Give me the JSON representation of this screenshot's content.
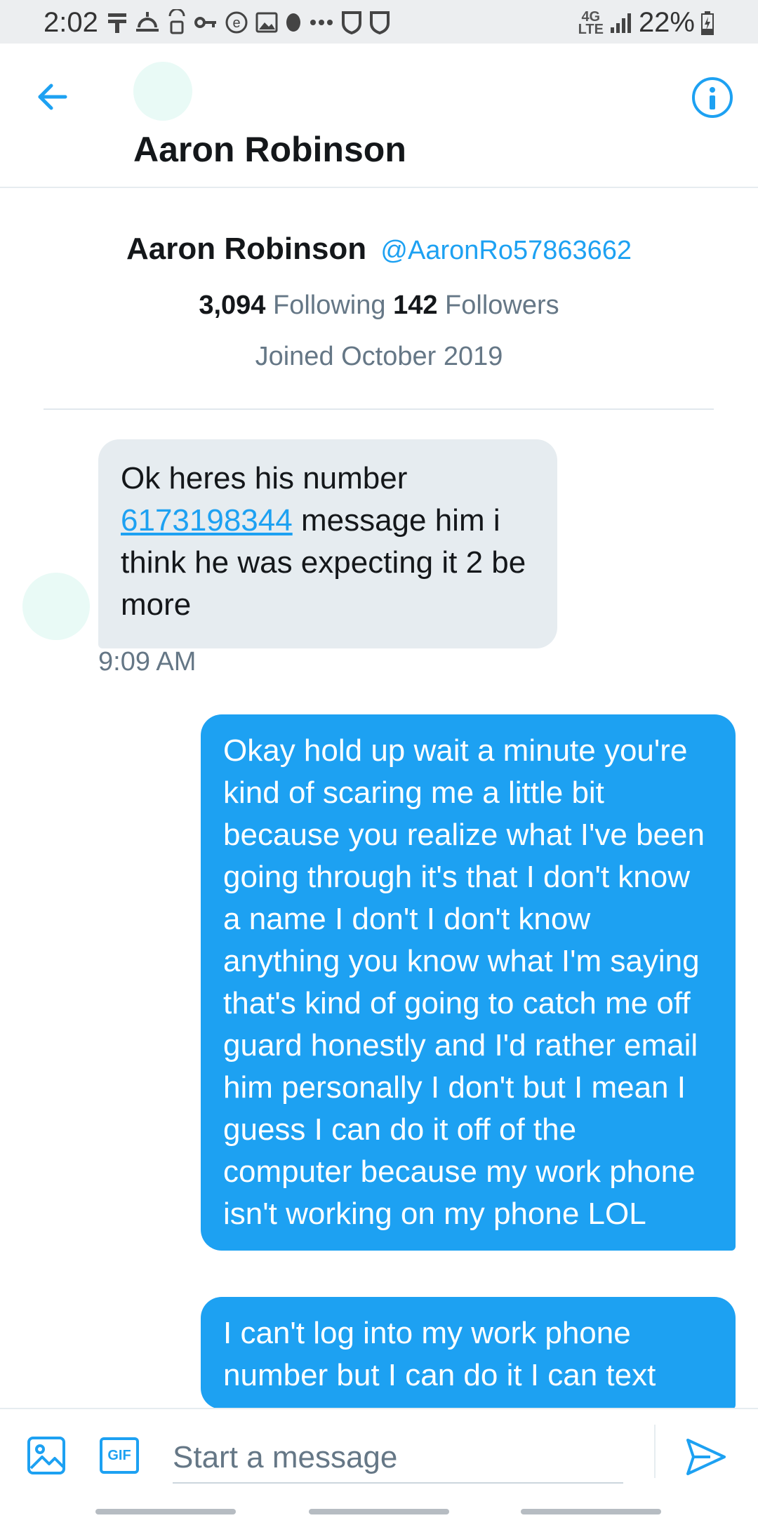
{
  "status_bar": {
    "time": "2:02",
    "network": "4G",
    "network_sub": "LTE",
    "battery": "22%",
    "icons": [
      "notification-icon",
      "weather-icon",
      "vpn-lock-icon",
      "key-icon",
      "browser-e-icon",
      "image-icon",
      "dot-icon",
      "more-dots-icon",
      "shield-icon",
      "shield-icon"
    ]
  },
  "header": {
    "title": "Aaron Robinson",
    "back_icon": "arrow-left-icon",
    "info_icon": "info-icon"
  },
  "profile": {
    "name": "Aaron Robinson",
    "handle": "@AaronRo57863662",
    "following_count": "3,094",
    "following_label": "Following",
    "followers_count": "142",
    "followers_label": "Followers",
    "joined": "Joined October 2019"
  },
  "messages": {
    "incoming": {
      "pre": "Ok heres his number ",
      "link": "6173198344",
      "post": " message him i think he was expecting it 2 be more",
      "time": "9:09 AM"
    },
    "outgoing": [
      {
        "text": "Okay hold up wait a minute you're kind of scaring me a little bit because you realize what I've been going through it's that I don't know a name I don't I don't know anything you know what I'm saying that's kind of going to catch me off guard honestly and I'd rather email him personally I don't but I mean I guess I can do it off of the computer because my work phone isn't working on my phone LOL"
      },
      {
        "text": "I can't log into my work phone number but I can do it I can text"
      }
    ]
  },
  "composer": {
    "placeholder": "Start a message",
    "gif_label": "GIF",
    "media_icon": "image-icon",
    "send_icon": "send-icon"
  },
  "colors": {
    "accent": "#1da1f2",
    "incoming_bubble": "#e6ecf0",
    "secondary_text": "#657786"
  }
}
